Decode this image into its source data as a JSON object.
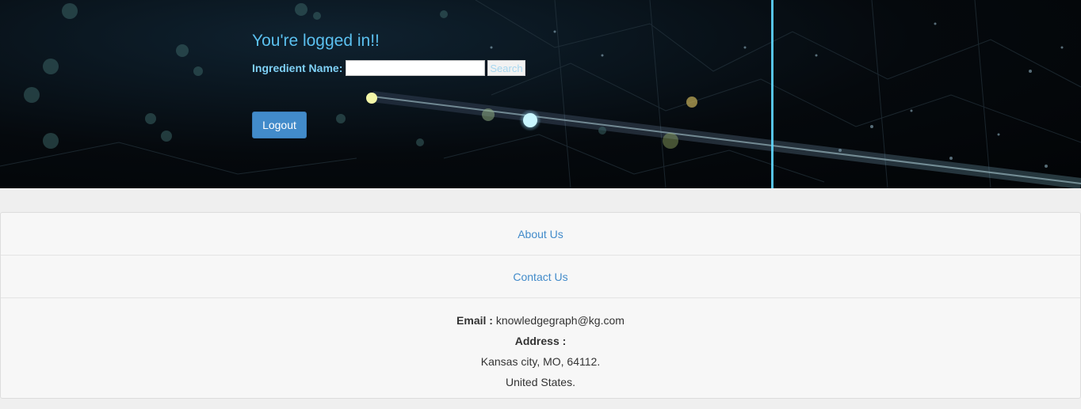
{
  "header": {
    "welcome": "You're logged in!!",
    "search_label": "Ingredient Name:",
    "search_value": "",
    "search_placeholder": "",
    "search_button": "Search",
    "logout_button": "Logout"
  },
  "footer": {
    "about_link": "About Us",
    "contact_link": "Contact Us",
    "email_label": "Email :",
    "email_value": "knowledgegraph@kg.com",
    "address_label": "Address :",
    "address_line1": "Kansas city, MO, 64112.",
    "address_line2": "United States."
  },
  "colors": {
    "accent_text": "#5bc0ef",
    "button_primary": "#428bca",
    "link": "#428bca"
  }
}
